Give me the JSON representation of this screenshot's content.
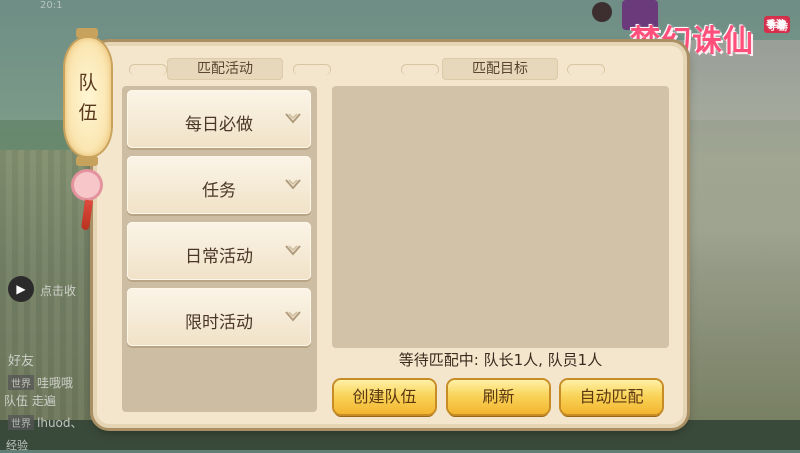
{
  "background": {
    "top_time": "20:1",
    "chat": {
      "quick_label": "点击收",
      "friends_label": "好友",
      "lines": [
        {
          "tag": "世界",
          "text": "哇哦哦"
        },
        {
          "tag": "",
          "text": "队伍 走遍"
        },
        {
          "tag": "世界",
          "text": "lhuod、"
        }
      ],
      "bottom_label": "经验"
    }
  },
  "logo": {
    "text": "梦幻诛仙",
    "seal": "手游"
  },
  "side_tab": {
    "char1": "队",
    "char2": "伍"
  },
  "dialog": {
    "left_title": "匹配活动",
    "right_title": "匹配目标",
    "activities": [
      {
        "label": "每日必做"
      },
      {
        "label": "任务"
      },
      {
        "label": "日常活动"
      },
      {
        "label": "限时活动"
      }
    ],
    "status_text": "等待匹配中: 队长1人, 队员1人",
    "buttons": {
      "create": "创建队伍",
      "refresh": "刷新",
      "auto_match": "自动匹配"
    }
  },
  "colors": {
    "panel_bg": "#f3e6cc",
    "gold_button": "#f3b52f",
    "logo_pink": "#ff4f7a"
  }
}
